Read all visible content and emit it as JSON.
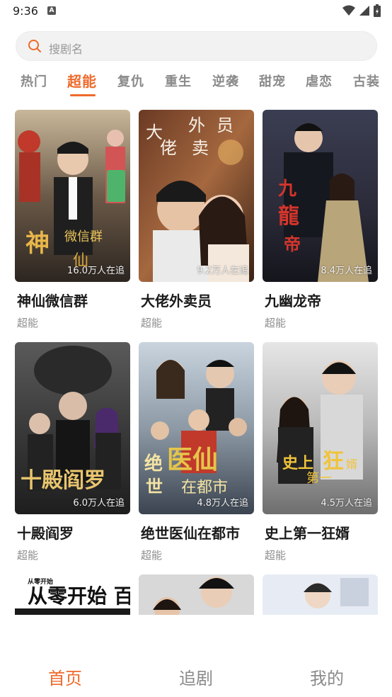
{
  "status_bar": {
    "time": "9:36",
    "notification_badge": "A"
  },
  "search": {
    "placeholder": "搜剧名"
  },
  "tabs": [
    {
      "label": "热门",
      "active": false
    },
    {
      "label": "超能",
      "active": true
    },
    {
      "label": "复仇",
      "active": false
    },
    {
      "label": "重生",
      "active": false
    },
    {
      "label": "逆袭",
      "active": false
    },
    {
      "label": "甜宠",
      "active": false
    },
    {
      "label": "虐恋",
      "active": false
    },
    {
      "label": "古装",
      "active": false
    }
  ],
  "dramas": [
    {
      "title": "神仙微信群",
      "tag": "超能",
      "viewers": "16.0万人在追",
      "poster_text": "神仙微信群"
    },
    {
      "title": "大佬外卖员",
      "tag": "超能",
      "viewers": "9.2万人在追",
      "poster_text": "大佬外卖员"
    },
    {
      "title": "九幽龙帝",
      "tag": "超能",
      "viewers": "8.4万人在追",
      "poster_text": "九幽龍帝"
    },
    {
      "title": "十殿阎罗",
      "tag": "超能",
      "viewers": "6.0万人在追",
      "poster_text": "十殿阎罗"
    },
    {
      "title": "绝世医仙在都市",
      "tag": "超能",
      "viewers": "4.8万人在追",
      "poster_text": "绝世医仙在都市"
    },
    {
      "title": "史上第一狂婿",
      "tag": "超能",
      "viewers": "4.5万人在追",
      "poster_text": "史上第一狂婿"
    }
  ],
  "partial_posters": [
    {
      "poster_text": "从零开始 百亿创业"
    },
    {
      "poster_text": ""
    },
    {
      "poster_text": ""
    }
  ],
  "bottom_nav": [
    {
      "label": "首页",
      "active": true
    },
    {
      "label": "追剧",
      "active": false
    },
    {
      "label": "我的",
      "active": false
    }
  ],
  "colors": {
    "accent": "#ee6a2c",
    "inactive": "#8a8a8a"
  }
}
